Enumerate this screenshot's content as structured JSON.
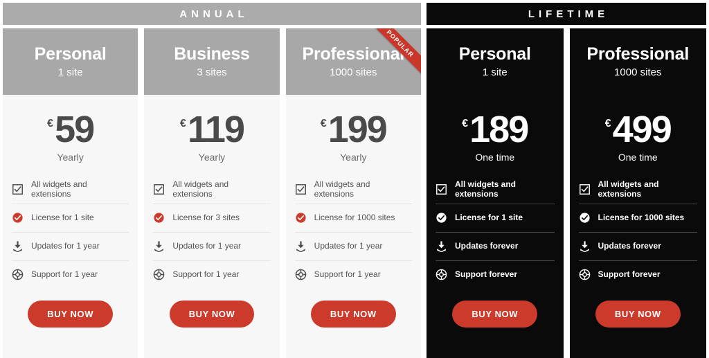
{
  "sections": [
    {
      "id": "annual",
      "banner": "ANNUAL",
      "theme": "light",
      "plans": [
        {
          "name": "Personal",
          "sites": "1 site",
          "currency": "€",
          "amount": "59",
          "period": "Yearly",
          "ribbon": null,
          "features": [
            {
              "icon": "checkbox-icon",
              "label": "All widgets and extensions",
              "style": "neutral"
            },
            {
              "icon": "license-check-icon",
              "label": "License for 1 site",
              "style": "accent"
            },
            {
              "icon": "download-icon",
              "label": "Updates for 1 year",
              "style": "neutral"
            },
            {
              "icon": "lifebuoy-icon",
              "label": "Support for 1 year",
              "style": "neutral"
            }
          ],
          "cta": "BUY NOW"
        },
        {
          "name": "Business",
          "sites": "3 sites",
          "currency": "€",
          "amount": "119",
          "period": "Yearly",
          "ribbon": null,
          "features": [
            {
              "icon": "checkbox-icon",
              "label": "All widgets and extensions",
              "style": "neutral"
            },
            {
              "icon": "license-check-icon",
              "label": "License for 3 sites",
              "style": "accent"
            },
            {
              "icon": "download-icon",
              "label": "Updates for 1 year",
              "style": "neutral"
            },
            {
              "icon": "lifebuoy-icon",
              "label": "Support for 1 year",
              "style": "neutral"
            }
          ],
          "cta": "BUY NOW"
        },
        {
          "name": "Professional",
          "sites": "1000 sites",
          "currency": "€",
          "amount": "199",
          "period": "Yearly",
          "ribbon": "POPULAR",
          "features": [
            {
              "icon": "checkbox-icon",
              "label": "All widgets and extensions",
              "style": "neutral"
            },
            {
              "icon": "license-check-icon",
              "label": "License for 1000 sites",
              "style": "accent"
            },
            {
              "icon": "download-icon",
              "label": "Updates for 1 year",
              "style": "neutral"
            },
            {
              "icon": "lifebuoy-icon",
              "label": "Support for 1 year",
              "style": "neutral"
            }
          ],
          "cta": "BUY NOW"
        }
      ]
    },
    {
      "id": "lifetime",
      "banner": "LIFETIME",
      "theme": "dark",
      "plans": [
        {
          "name": "Personal",
          "sites": "1 site",
          "currency": "€",
          "amount": "189",
          "period": "One time",
          "ribbon": null,
          "features": [
            {
              "icon": "checkbox-icon",
              "label": "All widgets and extensions",
              "style": "neutral"
            },
            {
              "icon": "license-check-icon",
              "label": "License for 1 site",
              "style": "neutral"
            },
            {
              "icon": "download-icon",
              "label": "Updates forever",
              "style": "neutral"
            },
            {
              "icon": "lifebuoy-icon",
              "label": "Support forever",
              "style": "neutral"
            }
          ],
          "cta": "BUY NOW"
        },
        {
          "name": "Professional",
          "sites": "1000 sites",
          "currency": "€",
          "amount": "499",
          "period": "One time",
          "ribbon": null,
          "features": [
            {
              "icon": "checkbox-icon",
              "label": "All widgets and extensions",
              "style": "neutral"
            },
            {
              "icon": "license-check-icon",
              "label": "License for 1000 sites",
              "style": "neutral"
            },
            {
              "icon": "download-icon",
              "label": "Updates forever",
              "style": "neutral"
            },
            {
              "icon": "lifebuoy-icon",
              "label": "Support forever",
              "style": "neutral"
            }
          ],
          "cta": "BUY NOW"
        }
      ]
    }
  ],
  "colors": {
    "accent_red": "#cc3a2b",
    "ribbon_red": "#c9372a",
    "banner_gray": "#ababab",
    "card_head_gray": "#a8a8a8",
    "card_light_bg": "#f7f7f7",
    "card_dark_bg": "#0a0a0a"
  }
}
